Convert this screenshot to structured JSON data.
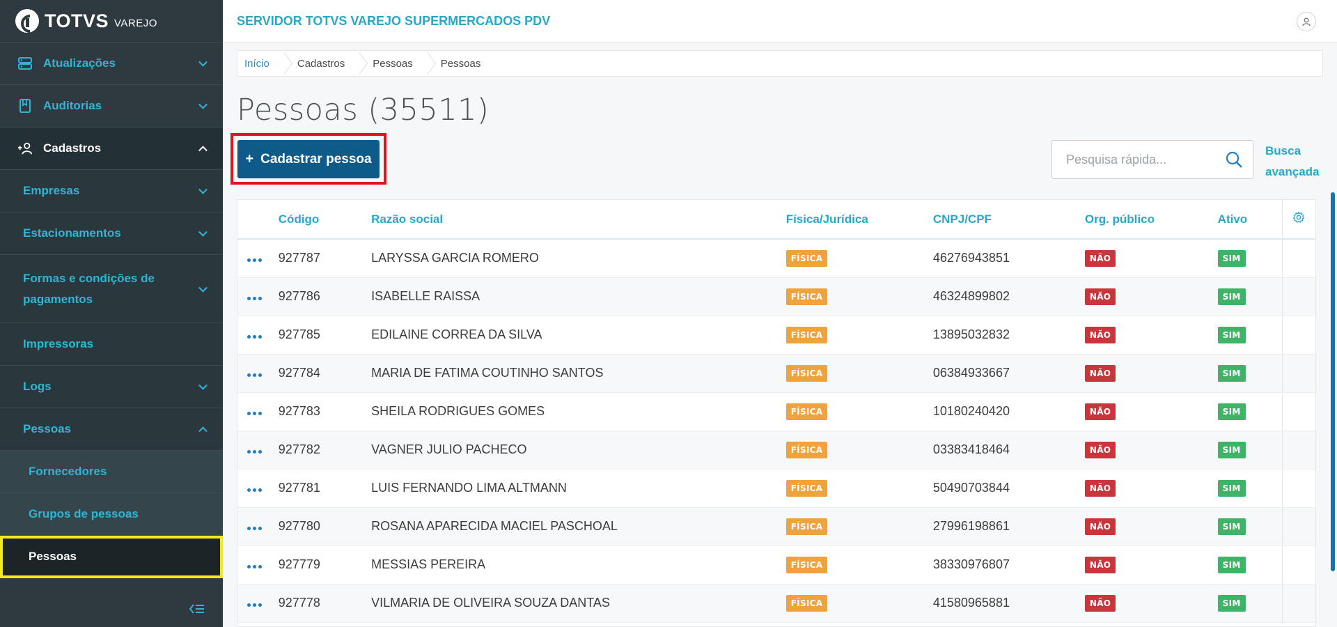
{
  "brand": {
    "name": "TOTVS",
    "sub": "VAREJO"
  },
  "sidebar": {
    "items": [
      {
        "label": "Atualizações"
      },
      {
        "label": "Auditorias"
      },
      {
        "label": "Cadastros"
      }
    ],
    "sub_items": [
      {
        "label": "Empresas"
      },
      {
        "label": "Estacionamentos"
      },
      {
        "label": "Formas e condições de pagamentos"
      },
      {
        "label": "Impressoras"
      },
      {
        "label": "Logs"
      },
      {
        "label": "Pessoas"
      }
    ],
    "sub_sub_items": [
      {
        "label": "Fornecedores"
      },
      {
        "label": "Grupos de pessoas"
      },
      {
        "label": "Pessoas"
      }
    ]
  },
  "header": {
    "server": "SERVIDOR TOTVS VAREJO SUPERMERCADOS PDV"
  },
  "breadcrumb": [
    "Início",
    "Cadastros",
    "Pessoas",
    "Pessoas"
  ],
  "page": {
    "title": "Pessoas (35511)",
    "add_button": "Cadastrar pessoa",
    "search_placeholder": "Pesquisa rápida...",
    "advanced_search": "Busca avançada"
  },
  "table": {
    "columns": [
      "Código",
      "Razão social",
      "Física/Jurídica",
      "CNPJ/CPF",
      "Org. público",
      "Ativo"
    ],
    "rows": [
      {
        "code": "927787",
        "name": "LARYSSA GARCIA ROMERO",
        "type": "FÍSICA",
        "doc": "46276943851",
        "org": "NÃO",
        "active": "SIM"
      },
      {
        "code": "927786",
        "name": "ISABELLE RAISSA",
        "type": "FÍSICA",
        "doc": "46324899802",
        "org": "NÃO",
        "active": "SIM"
      },
      {
        "code": "927785",
        "name": "EDILAINE CORREA DA SILVA",
        "type": "FÍSICA",
        "doc": "13895032832",
        "org": "NÃO",
        "active": "SIM"
      },
      {
        "code": "927784",
        "name": "MARIA DE FATIMA COUTINHO SANTOS",
        "type": "FÍSICA",
        "doc": "06384933667",
        "org": "NÃO",
        "active": "SIM"
      },
      {
        "code": "927783",
        "name": "SHEILA RODRIGUES GOMES",
        "type": "FÍSICA",
        "doc": "10180240420",
        "org": "NÃO",
        "active": "SIM"
      },
      {
        "code": "927782",
        "name": "VAGNER JULIO PACHECO",
        "type": "FÍSICA",
        "doc": "03383418464",
        "org": "NÃO",
        "active": "SIM"
      },
      {
        "code": "927781",
        "name": "LUIS FERNANDO LIMA ALTMANN",
        "type": "FÍSICA",
        "doc": "50490703844",
        "org": "NÃO",
        "active": "SIM"
      },
      {
        "code": "927780",
        "name": "ROSANA APARECIDA MACIEL PASCHOAL",
        "type": "FÍSICA",
        "doc": "27996198861",
        "org": "NÃO",
        "active": "SIM"
      },
      {
        "code": "927779",
        "name": "MESSIAS PEREIRA",
        "type": "FÍSICA",
        "doc": "38330976807",
        "org": "NÃO",
        "active": "SIM"
      },
      {
        "code": "927778",
        "name": "VILMARIA DE OLIVEIRA SOUZA DANTAS",
        "type": "FÍSICA",
        "doc": "41580965881",
        "org": "NÃO",
        "active": "SIM"
      }
    ]
  },
  "colors": {
    "sidebar_bg": "#2e3a3f",
    "accent": "#28a7c8",
    "primary_button": "#0e5b8a",
    "tag_fisica": "#efa33c",
    "tag_nao": "#c8353b",
    "tag_sim": "#3fb467",
    "highlight_red": "#e0141e",
    "highlight_yellow": "#f2ea1c"
  },
  "icons": {
    "atualizacoes": "server-icon",
    "auditorias": "book-icon",
    "cadastros": "add-user-icon",
    "search": "search-icon",
    "settings": "gear-icon",
    "user": "user-icon",
    "collapse": "collapse-menu-icon",
    "row_actions": "more-dots-icon"
  }
}
